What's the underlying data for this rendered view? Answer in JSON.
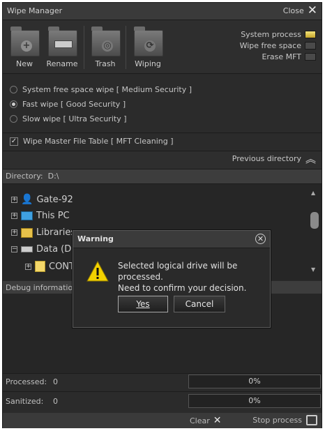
{
  "window": {
    "title": "Wipe Manager",
    "close_label": "Close"
  },
  "toolbar": {
    "buttons": [
      {
        "label": "New",
        "icon": "folder-plus-icon"
      },
      {
        "label": "Rename",
        "icon": "folder-rename-icon"
      },
      {
        "label": "Trash",
        "icon": "trash-icon"
      },
      {
        "label": "Wiping",
        "icon": "wipe-icon"
      }
    ],
    "status": [
      {
        "label": "System process",
        "active": true
      },
      {
        "label": "Wipe free space",
        "active": false
      },
      {
        "label": "Erase MFT",
        "active": false
      }
    ]
  },
  "options": [
    {
      "label": "System free space wipe [ Medium Security ]",
      "selected": false
    },
    {
      "label": "Fast wipe [ Good Security ]",
      "selected": true
    },
    {
      "label": "Slow wipe [ Ultra Security ]",
      "selected": false
    }
  ],
  "mft_checkbox": {
    "label": "Wipe Master File Table [ MFT Cleaning ]",
    "checked": true
  },
  "previous_directory": "Previous directory",
  "directory": {
    "label": "Directory:",
    "path": "D:\\"
  },
  "tree": [
    {
      "label": "Gate-92",
      "icon": "user-icon"
    },
    {
      "label": "This PC",
      "icon": "computer-icon"
    },
    {
      "label": "Libraries",
      "icon": "library-icon"
    },
    {
      "label": "Data (D:)",
      "icon": "drive-icon"
    },
    {
      "label": "CONT",
      "icon": "folder-icon"
    }
  ],
  "debug_label": "Debug information:",
  "processed": {
    "label": "Processed:",
    "count": "0",
    "percent": "0%"
  },
  "sanitized": {
    "label": "Sanitized:",
    "count": "0",
    "percent": "0%"
  },
  "bottom": {
    "clear_label": "Clear",
    "stop_label": "Stop process"
  },
  "dialog": {
    "title": "Warning",
    "message_line1": "Selected logical drive will be processed.",
    "message_line2": "Need to confirm your decision.",
    "yes_label": "Yes",
    "cancel_label": "Cancel"
  },
  "colors": {
    "accent": "#e8c84a",
    "background": "#2b2b2b"
  }
}
